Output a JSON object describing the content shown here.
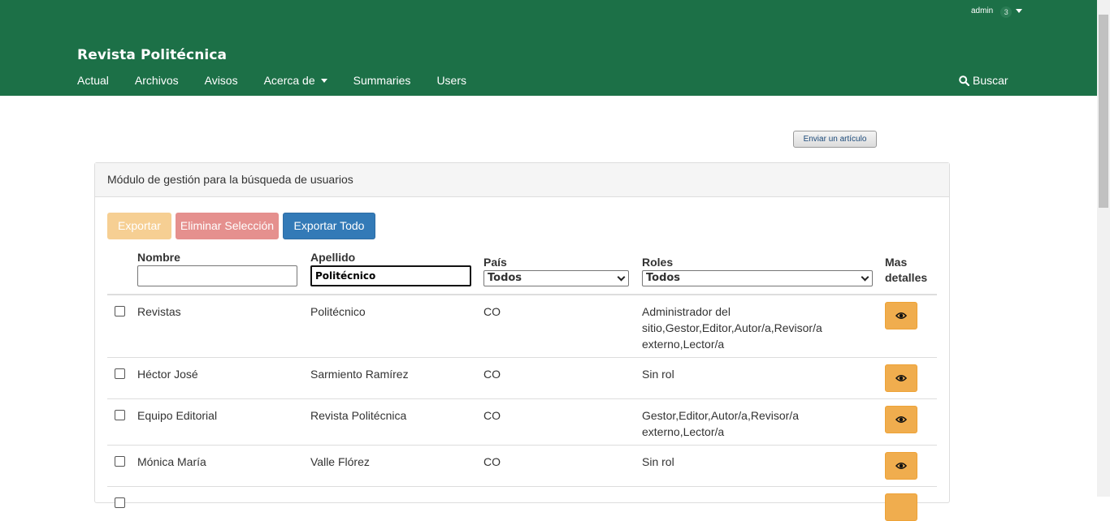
{
  "header": {
    "user": "admin",
    "notifications": "3",
    "site_title": "Revista Politécnica",
    "nav": [
      "Actual",
      "Archivos",
      "Avisos",
      "Acerca de",
      "Summaries",
      "Users"
    ],
    "search_label": "Buscar",
    "bg_color": "#1c7047"
  },
  "submit_button": "Enviar un artículo",
  "panel": {
    "title": "Módulo de gestión para la búsqueda de usuarios",
    "buttons": {
      "export": "Exportar",
      "delete_selection": "Eliminar Selección",
      "export_all": "Exportar Todo"
    },
    "columns": {
      "nombre": "Nombre",
      "apellido": "Apellido",
      "pais": "País",
      "roles": "Roles",
      "details_1": "Mas",
      "details_2": "detalles"
    },
    "filters": {
      "nombre_value": "",
      "apellido_value": "Politécnico",
      "pais_selected": "Todos",
      "roles_selected": "Todos"
    },
    "rows": [
      {
        "nombre": "Revistas",
        "apellido": "Politécnico",
        "pais": "CO",
        "roles_lines": [
          "Administrador del",
          "sitio,Gestor,Editor,Autor/a,Revisor/a",
          "externo,Lector/a"
        ]
      },
      {
        "nombre": "Héctor José",
        "apellido": "Sarmiento Ramírez",
        "pais": "CO",
        "roles_lines": [
          "Sin rol"
        ]
      },
      {
        "nombre": "Equipo Editorial",
        "apellido": "Revista Politécnica",
        "pais": "CO",
        "roles_lines": [
          "Gestor,Editor,Autor/a,Revisor/a",
          "externo,Lector/a"
        ]
      },
      {
        "nombre": "Mónica María",
        "apellido": "Valle Flórez",
        "pais": "CO",
        "roles_lines": [
          "Sin rol"
        ]
      }
    ]
  }
}
